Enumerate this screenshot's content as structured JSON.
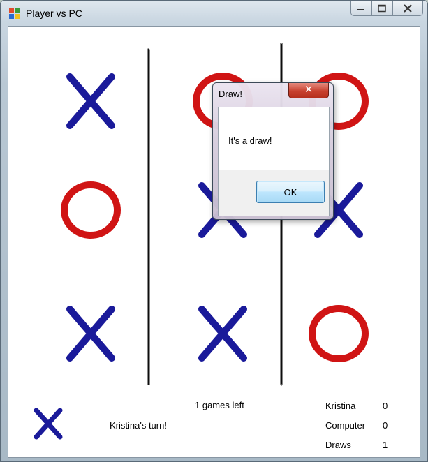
{
  "window": {
    "title": "Player vs PC",
    "minimize_icon": "minimize-icon",
    "maximize_icon": "maximize-icon",
    "close_icon": "close-icon"
  },
  "board": {
    "cells": [
      "X",
      "O",
      "O",
      "O",
      "X",
      "X",
      "X",
      "X",
      "O"
    ],
    "x_color": "#1a1a9a",
    "o_color": "#d01414",
    "grid_color": "#0a0a0a"
  },
  "status": {
    "games_left": "1 games left",
    "turn": "Kristina's turn!",
    "current_mark": "X",
    "scores": [
      {
        "name": "Kristina",
        "value": "0"
      },
      {
        "name": "Computer",
        "value": "0"
      },
      {
        "name": "Draws",
        "value": "1"
      }
    ]
  },
  "dialog": {
    "title": "Draw!",
    "message": "It's a draw!",
    "ok_label": "OK",
    "close_glyph": "✕"
  }
}
